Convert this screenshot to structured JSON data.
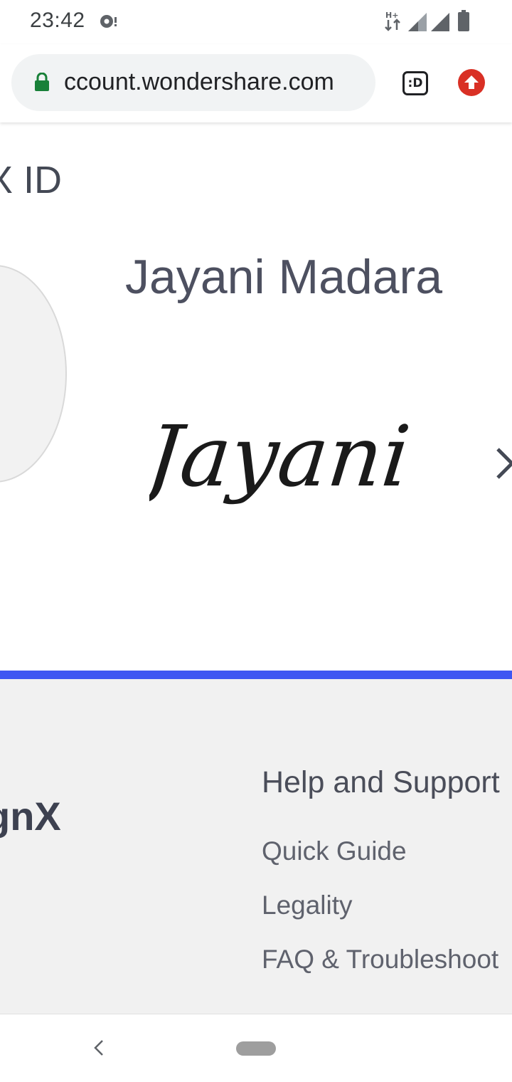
{
  "status_bar": {
    "time": "23:42",
    "network_label": "H+",
    "icons": [
      "notification-icon",
      "data-transfer-icon",
      "signal-icon",
      "signal-icon",
      "battery-icon"
    ]
  },
  "browser": {
    "url": "ccount.wondershare.com",
    "tab_count": ":D",
    "icons": [
      "lock-icon",
      "tabs-icon",
      "update-icon"
    ]
  },
  "page": {
    "heading": "X ID",
    "user_name": "Jayani Madara",
    "signature_text": "Jayani",
    "icons": [
      "avatar-icon",
      "chevron-right-icon"
    ],
    "accent_color": "#3f56f2"
  },
  "footer": {
    "brand": "gnX",
    "help": {
      "title": "Help and Support",
      "links": [
        "Quick Guide",
        "Legality",
        "FAQ & Troubleshoot"
      ]
    }
  },
  "navbar": {
    "icons": [
      "back-icon",
      "home-pill-icon"
    ]
  }
}
